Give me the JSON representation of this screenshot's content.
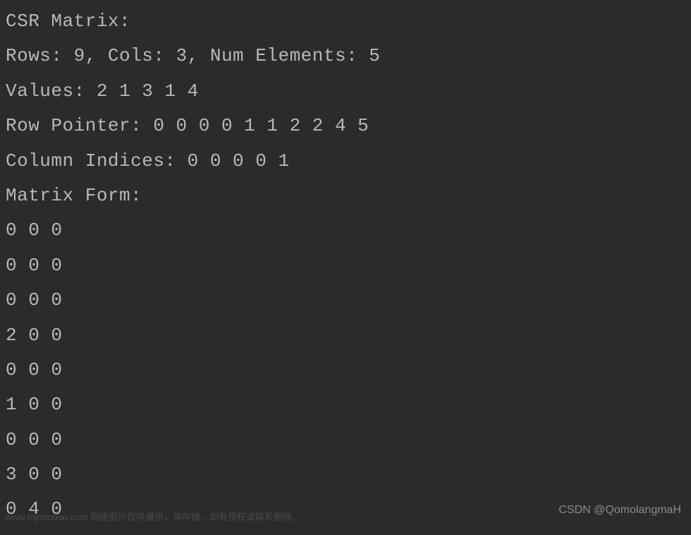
{
  "lines": {
    "title": "CSR Matrix:",
    "dims": "Rows: 9, Cols: 3, Num Elements: 5",
    "values": "Values: 2 1 3 1 4",
    "row_pointer": "Row Pointer: 0 0 0 0 1 1 2 2 4 5",
    "col_indices": "Column Indices: 0 0 0 0 1",
    "matrix_form": "Matrix Form:",
    "r0": "0 0 0",
    "r1": "0 0 0",
    "r2": "0 0 0",
    "r3": "2 0 0",
    "r4": "0 0 0",
    "r5": "1 0 0",
    "r6": "0 0 0",
    "r7": "3 0 0",
    "r8": "0 4 0"
  },
  "watermark": {
    "left": "www.toymoban.com 网络图片仅供展示，非存储，如有侵权请联系删除。",
    "right": "CSDN @QomolangmaH"
  }
}
